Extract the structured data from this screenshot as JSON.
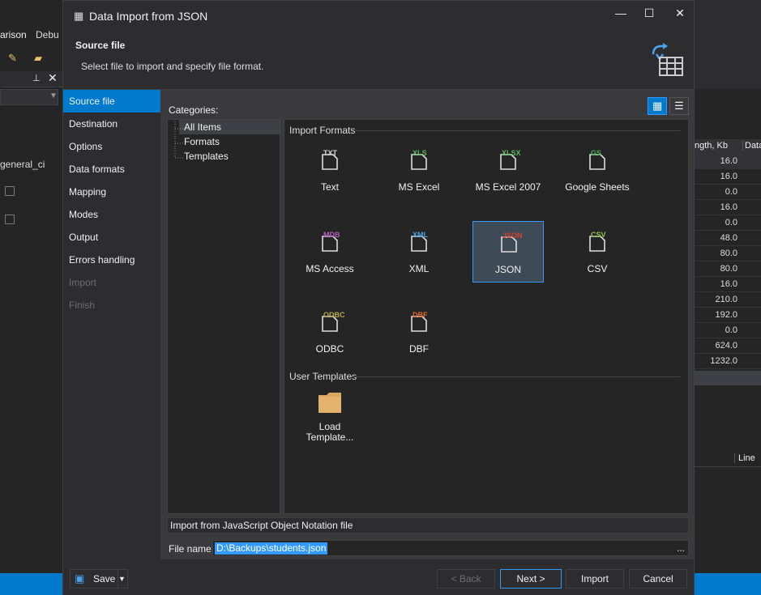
{
  "background": {
    "menu": [
      "arison",
      "Debu"
    ],
    "left_field": "general_ci",
    "grid_header": [
      "ngth, Kb",
      "Data"
    ],
    "grid_values": [
      "16.0",
      "16.0",
      "0.0",
      "16.0",
      "0.0",
      "48.0",
      "80.0",
      "80.0",
      "16.0",
      "210.0",
      "192.0",
      "0.0",
      "624.0",
      "1232.0"
    ],
    "line_header": "Line"
  },
  "dialog": {
    "title": "Data Import from JSON",
    "header_title": "Source file",
    "header_subtitle": "Select file to import and specify file format.",
    "nav": [
      "Source file",
      "Destination",
      "Options",
      "Data formats",
      "Mapping",
      "Modes",
      "Output",
      "Errors handling",
      "Import",
      "Finish"
    ],
    "categories_label": "Categories:",
    "tree": [
      "All Items",
      "Formats",
      "Templates"
    ],
    "group_formats": "Import Formats",
    "formats": [
      {
        "label": "Text",
        "tag": "TXT",
        "color": "#d0d0d0"
      },
      {
        "label": "MS Excel",
        "tag": "XLS",
        "color": "#5cb85c"
      },
      {
        "label": "MS Excel 2007",
        "tag": "XLSX",
        "color": "#5cb85c"
      },
      {
        "label": "Google Sheets",
        "tag": "GS",
        "color": "#4caf50"
      },
      {
        "label": "MS Access",
        "tag": "MDB",
        "color": "#b05cb8"
      },
      {
        "label": "XML",
        "tag": "XML",
        "color": "#4a9fe0"
      },
      {
        "label": "JSON",
        "tag": "JSON",
        "color": "#d9402b"
      },
      {
        "label": "CSV",
        "tag": "CSV",
        "color": "#8bc34a"
      },
      {
        "label": "ODBC",
        "tag": "ODBC",
        "color": "#b8a84a"
      },
      {
        "label": "DBF",
        "tag": "DBF",
        "color": "#e06a2b"
      }
    ],
    "group_templates": "User Templates",
    "template_item": {
      "line1": "Load",
      "line2": "Template..."
    },
    "description": "Import from JavaScript Object Notation file",
    "file_label": "File name:",
    "file_value": "D:\\Backups\\students.json",
    "browse": "...",
    "buttons": {
      "save": "Save",
      "back": "< Back",
      "next": "Next >",
      "import": "Import",
      "cancel": "Cancel"
    }
  }
}
